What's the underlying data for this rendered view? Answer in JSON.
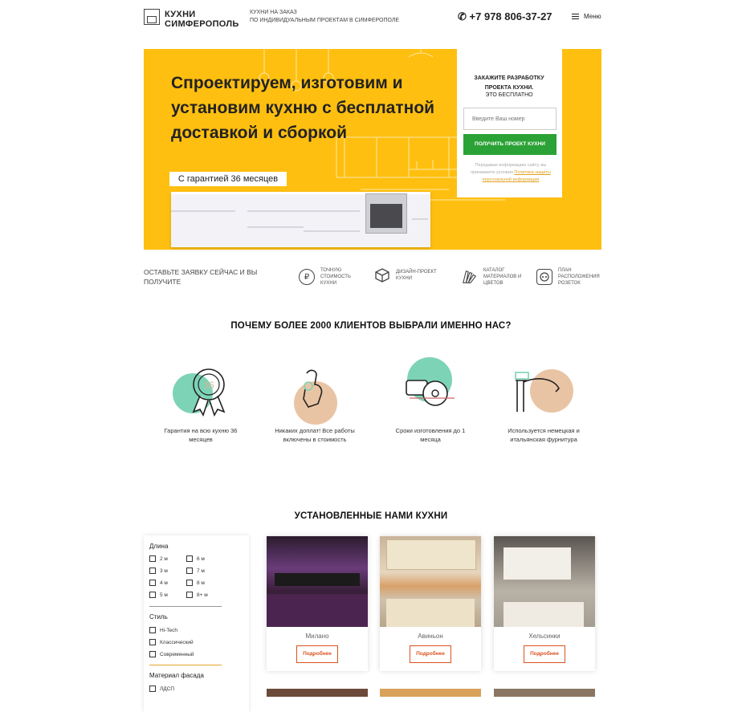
{
  "header": {
    "logo": "КУХНИ СИМФЕРОПОЛЬ",
    "logo_line1": "КУХНИ",
    "logo_line2": "СИМФЕРОПОЛЬ",
    "tagline_line1": "КУХНИ НА ЗАКАЗ",
    "tagline_line2": "ПО ИНДИВИДУАЛЬНЫМ ПРОЕКТАМ В СИМФЕРОПОЛЕ",
    "phone": "+7 978 806-37-27",
    "menu_label": "Меню"
  },
  "hero": {
    "title": "Спроектируем, изготовим и установим кухню с бесплатной доставкой и сборкой",
    "badge": "С гарантией 36 месяцев",
    "accent_color": "#ffbf10"
  },
  "order_form": {
    "title": "ЗАКАЖИТЕ РАЗРАБОТКУ ПРОЕКТА КУХНИ.",
    "subtitle": "ЭТО БЕСПЛАТНО",
    "phone_placeholder": "Введите Ваш номер",
    "submit_label": "ПОЛУЧИТЬ ПРОЕКТ КУХНИ",
    "policy_text": "Передавая информацию сайту, вы принимаете условия",
    "policy_link": "Политики защиты персональной информации",
    "button_color": "#2ba235"
  },
  "benefits": {
    "intro": "ОСТАВЬТЕ ЗАЯВКУ СЕЙЧАС И ВЫ ПОЛУЧИТЕ",
    "items": [
      {
        "icon": "ruble-icon",
        "label": "ТОЧНУЮ СТОИМОСТЬ КУХНИ"
      },
      {
        "icon": "cube-icon",
        "label": "ДИЗАЙН-ПРОЕКТ КУХНИ"
      },
      {
        "icon": "swatches-icon",
        "label": "КАТАЛОГ МАТЕРИАЛОВ И ЦВЕТОВ"
      },
      {
        "icon": "socket-icon",
        "label": "ПЛАН РАСПОЛОЖЕНИЯ РОЗЕТОК"
      }
    ]
  },
  "why": {
    "heading": "ПОЧЕМУ БОЛЕЕ 2000 КЛИЕНТОВ ВЫБРАЛИ ИМЕННО НАС?",
    "features": [
      {
        "icon": "medal-icon",
        "text": "Гарантия на всю кухню 36 месяцев",
        "medal_number": "36"
      },
      {
        "icon": "ok-hand-icon",
        "text": "Никаких доплат! Все работы включены в стоимость"
      },
      {
        "icon": "saw-icon",
        "text": "Сроки изготовления до 1 месяца"
      },
      {
        "icon": "faucet-icon",
        "text": "Используется немецкая и итальянская фурнитура"
      }
    ]
  },
  "installed": {
    "heading": "УСТАНОВЛЕННЫЕ НАМИ КУХНИ",
    "filters": {
      "length_title": "Длина",
      "length_options": [
        "2 м",
        "6 м",
        "3 м",
        "7 м",
        "4 м",
        "8 м",
        "5 м",
        "8+ м"
      ],
      "style_title": "Стиль",
      "style_options": [
        "Hi-Tech",
        "Классический",
        "Современный"
      ],
      "facade_title": "Материал фасада",
      "facade_options": [
        "ЛДСП"
      ]
    },
    "cards": [
      {
        "name": "Милано",
        "button": "Подробнее"
      },
      {
        "name": "Авиньон",
        "button": "Подробнее"
      },
      {
        "name": "Хельсинки",
        "button": "Подробнее"
      }
    ]
  }
}
